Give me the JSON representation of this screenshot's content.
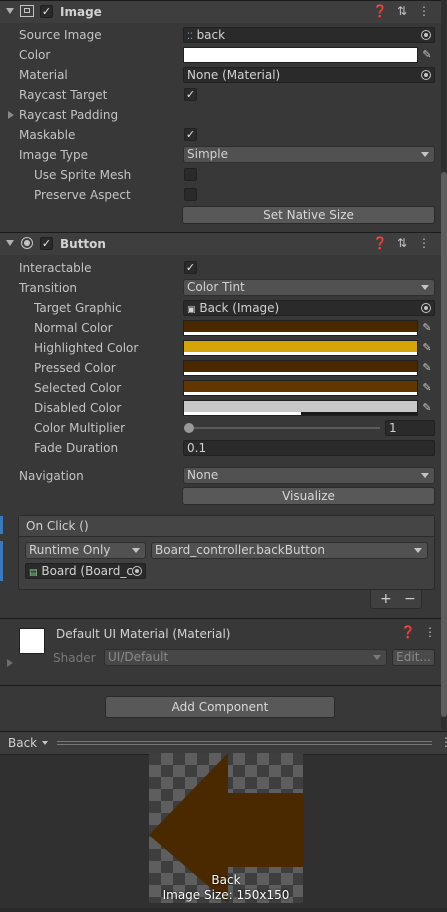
{
  "image_component": {
    "title": "Image",
    "source_image": {
      "label": "Source Image",
      "value": "back"
    },
    "color": {
      "label": "Color",
      "hex": "#ffffff"
    },
    "material": {
      "label": "Material",
      "value": "None (Material)"
    },
    "raycast_target": {
      "label": "Raycast Target",
      "checked": "✓"
    },
    "raycast_padding": {
      "label": "Raycast Padding"
    },
    "maskable": {
      "label": "Maskable",
      "checked": "✓"
    },
    "image_type": {
      "label": "Image Type",
      "value": "Simple"
    },
    "use_sprite_mesh": {
      "label": "Use Sprite Mesh"
    },
    "preserve_aspect": {
      "label": "Preserve Aspect"
    },
    "set_native_size": "Set Native Size"
  },
  "button_component": {
    "title": "Button",
    "interactable": {
      "label": "Interactable",
      "checked": "✓"
    },
    "transition": {
      "label": "Transition",
      "value": "Color Tint"
    },
    "target_graphic": {
      "label": "Target Graphic",
      "value": "Back (Image)"
    },
    "normal_color": {
      "label": "Normal Color",
      "hex": "#4a2800"
    },
    "highlighted_color": {
      "label": "Highlighted Color",
      "hex": "#d4a408"
    },
    "pressed_color": {
      "label": "Pressed Color",
      "hex": "#4a2800"
    },
    "selected_color": {
      "label": "Selected Color",
      "hex": "#613600"
    },
    "disabled_color": {
      "label": "Disabled Color",
      "hex": "#c8c8c8"
    },
    "color_multiplier": {
      "label": "Color Multiplier",
      "value": "1"
    },
    "fade_duration": {
      "label": "Fade Duration",
      "value": "0.1"
    },
    "navigation": {
      "label": "Navigation",
      "value": "None"
    },
    "visualize": "Visualize",
    "on_click": {
      "title": "On Click ()",
      "runtime": "Runtime Only",
      "function": "Board_controller.backButton",
      "object": "Board (Board_c"
    },
    "plus": "+",
    "minus": "−"
  },
  "material_component": {
    "title": "Default UI Material (Material)",
    "shader_label": "Shader",
    "shader_value": "UI/Default",
    "edit": "Edit..."
  },
  "add_component": "Add Component",
  "preview": {
    "dropdown": "Back",
    "name": "Back",
    "size": "Image Size: 150x150"
  },
  "colors": {
    "panel": "#383838",
    "arrow": "#4a2800",
    "accent": "#3a79bb"
  }
}
